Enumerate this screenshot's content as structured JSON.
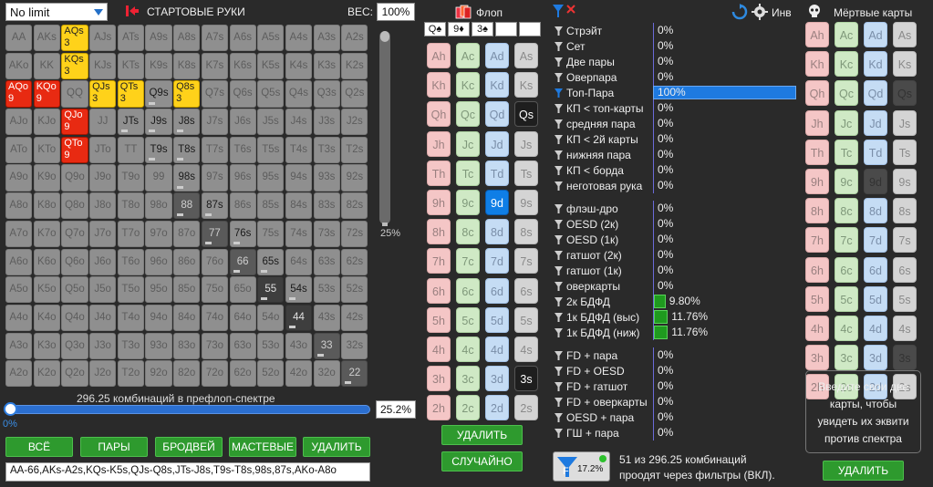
{
  "game_select": "No limit",
  "header": {
    "title": "СТАРТОВЫЕ РУКИ",
    "weight_label": "ВЕС:",
    "weight_value": "100%"
  },
  "grid": [
    [
      [
        "AA",
        "g"
      ],
      [
        "AKs",
        "g"
      ],
      [
        "AQs",
        "y",
        "3"
      ],
      [
        "AJs",
        "g"
      ],
      [
        "ATs",
        "g"
      ],
      [
        "A9s",
        "g"
      ],
      [
        "A8s",
        "g"
      ],
      [
        "A7s",
        "g"
      ],
      [
        "A6s",
        "g"
      ],
      [
        "A5s",
        "g"
      ],
      [
        "A4s",
        "g"
      ],
      [
        "A3s",
        "g"
      ],
      [
        "A2s",
        "g"
      ]
    ],
    [
      [
        "AKo",
        "g"
      ],
      [
        "KK",
        "g"
      ],
      [
        "KQs",
        "y",
        "3"
      ],
      [
        "KJs",
        "g"
      ],
      [
        "KTs",
        "g"
      ],
      [
        "K9s",
        "g"
      ],
      [
        "K8s",
        "g"
      ],
      [
        "K7s",
        "g"
      ],
      [
        "K6s",
        "g"
      ],
      [
        "K5s",
        "g"
      ],
      [
        "K4s",
        "g"
      ],
      [
        "K3s",
        "g"
      ],
      [
        "K2s",
        "g"
      ]
    ],
    [
      [
        "AQo",
        "r",
        "9"
      ],
      [
        "KQo",
        "r",
        "9"
      ],
      [
        "QQ",
        "g"
      ],
      [
        "QJs",
        "y",
        "3"
      ],
      [
        "QTs",
        "y",
        "3"
      ],
      [
        "Q9s",
        "w"
      ],
      [
        "Q8s",
        "y",
        "3"
      ],
      [
        "Q7s",
        "g"
      ],
      [
        "Q6s",
        "g"
      ],
      [
        "Q5s",
        "g"
      ],
      [
        "Q4s",
        "g"
      ],
      [
        "Q3s",
        "g"
      ],
      [
        "Q2s",
        "g"
      ]
    ],
    [
      [
        "AJo",
        "g"
      ],
      [
        "KJo",
        "g"
      ],
      [
        "QJo",
        "r",
        "9"
      ],
      [
        "JJ",
        "g"
      ],
      [
        "JTs",
        "w"
      ],
      [
        "J9s",
        "w"
      ],
      [
        "J8s",
        "w"
      ],
      [
        "J7s",
        "g"
      ],
      [
        "J6s",
        "g"
      ],
      [
        "J5s",
        "g"
      ],
      [
        "J4s",
        "g"
      ],
      [
        "J3s",
        "g"
      ],
      [
        "J2s",
        "g"
      ]
    ],
    [
      [
        "ATo",
        "g"
      ],
      [
        "KTo",
        "g"
      ],
      [
        "QTo",
        "r",
        "9"
      ],
      [
        "JTo",
        "g"
      ],
      [
        "TT",
        "g"
      ],
      [
        "T9s",
        "w"
      ],
      [
        "T8s",
        "w"
      ],
      [
        "T7s",
        "g"
      ],
      [
        "T6s",
        "g"
      ],
      [
        "T5s",
        "g"
      ],
      [
        "T4s",
        "g"
      ],
      [
        "T3s",
        "g"
      ],
      [
        "T2s",
        "g"
      ]
    ],
    [
      [
        "A9o",
        "g"
      ],
      [
        "K9o",
        "g"
      ],
      [
        "Q9o",
        "g"
      ],
      [
        "J9o",
        "g"
      ],
      [
        "T9o",
        "g"
      ],
      [
        "99",
        "g"
      ],
      [
        "98s",
        "w"
      ],
      [
        "97s",
        "g"
      ],
      [
        "96s",
        "g"
      ],
      [
        "95s",
        "g"
      ],
      [
        "94s",
        "g"
      ],
      [
        "93s",
        "g"
      ],
      [
        "92s",
        "g"
      ]
    ],
    [
      [
        "A8o",
        "g"
      ],
      [
        "K8o",
        "g"
      ],
      [
        "Q8o",
        "g"
      ],
      [
        "J8o",
        "g"
      ],
      [
        "T8o",
        "g"
      ],
      [
        "98o",
        "g"
      ],
      [
        "88",
        "d"
      ],
      [
        "87s",
        "w"
      ],
      [
        "86s",
        "g"
      ],
      [
        "85s",
        "g"
      ],
      [
        "84s",
        "g"
      ],
      [
        "83s",
        "g"
      ],
      [
        "82s",
        "g"
      ]
    ],
    [
      [
        "A7o",
        "g"
      ],
      [
        "K7o",
        "g"
      ],
      [
        "Q7o",
        "g"
      ],
      [
        "J7o",
        "g"
      ],
      [
        "T7o",
        "g"
      ],
      [
        "97o",
        "g"
      ],
      [
        "87o",
        "g"
      ],
      [
        "77",
        "d"
      ],
      [
        "76s",
        "w"
      ],
      [
        "75s",
        "g"
      ],
      [
        "74s",
        "g"
      ],
      [
        "73s",
        "g"
      ],
      [
        "72s",
        "g"
      ]
    ],
    [
      [
        "A6o",
        "g"
      ],
      [
        "K6o",
        "g"
      ],
      [
        "Q6o",
        "g"
      ],
      [
        "J6o",
        "g"
      ],
      [
        "T6o",
        "g"
      ],
      [
        "96o",
        "g"
      ],
      [
        "86o",
        "g"
      ],
      [
        "76o",
        "g"
      ],
      [
        "66",
        "d"
      ],
      [
        "65s",
        "w"
      ],
      [
        "64s",
        "g"
      ],
      [
        "63s",
        "g"
      ],
      [
        "62s",
        "g"
      ]
    ],
    [
      [
        "A5o",
        "g"
      ],
      [
        "K5o",
        "g"
      ],
      [
        "Q5o",
        "g"
      ],
      [
        "J5o",
        "g"
      ],
      [
        "T5o",
        "g"
      ],
      [
        "95o",
        "g"
      ],
      [
        "85o",
        "g"
      ],
      [
        "75o",
        "g"
      ],
      [
        "65o",
        "g"
      ],
      [
        "55",
        "e"
      ],
      [
        "54s",
        "w"
      ],
      [
        "53s",
        "g"
      ],
      [
        "52s",
        "g"
      ]
    ],
    [
      [
        "A4o",
        "g"
      ],
      [
        "K4o",
        "g"
      ],
      [
        "Q4o",
        "g"
      ],
      [
        "J4o",
        "g"
      ],
      [
        "T4o",
        "g"
      ],
      [
        "94o",
        "g"
      ],
      [
        "84o",
        "g"
      ],
      [
        "74o",
        "g"
      ],
      [
        "64o",
        "g"
      ],
      [
        "54o",
        "g"
      ],
      [
        "44",
        "e"
      ],
      [
        "43s",
        "g"
      ],
      [
        "42s",
        "g"
      ]
    ],
    [
      [
        "A3o",
        "g"
      ],
      [
        "K3o",
        "g"
      ],
      [
        "Q3o",
        "g"
      ],
      [
        "J3o",
        "g"
      ],
      [
        "T3o",
        "g"
      ],
      [
        "93o",
        "g"
      ],
      [
        "83o",
        "g"
      ],
      [
        "73o",
        "g"
      ],
      [
        "63o",
        "g"
      ],
      [
        "53o",
        "g"
      ],
      [
        "43o",
        "g"
      ],
      [
        "33",
        "d"
      ],
      [
        "32s",
        "g"
      ]
    ],
    [
      [
        "A2o",
        "g"
      ],
      [
        "K2o",
        "g"
      ],
      [
        "Q2o",
        "g"
      ],
      [
        "J2o",
        "g"
      ],
      [
        "T2o",
        "g"
      ],
      [
        "92o",
        "g"
      ],
      [
        "82o",
        "g"
      ],
      [
        "72o",
        "g"
      ],
      [
        "62o",
        "g"
      ],
      [
        "52o",
        "g"
      ],
      [
        "42o",
        "g"
      ],
      [
        "32o",
        "g"
      ],
      [
        "22",
        "d"
      ]
    ]
  ],
  "vslider_pct": "25%",
  "combos_text": "296.25 комбинаций в префлоп-спектре",
  "hslider_left": "0%",
  "hslider_value": "25.2%",
  "buttons": {
    "all": "ВСЁ",
    "pairs": "ПАРЫ",
    "broadway": "БРОДВЕЙ",
    "suited": "МАСТЕВЫЕ",
    "delete": "УДАЛИТЬ"
  },
  "range_text": "AA-66,AKs-A2s,KQs-K5s,QJs-Q8s,JTs-J8s,T9s-T8s,98s,87s,AKo-A8o",
  "flop": {
    "label": "Флоп",
    "slots": [
      "Q♠",
      "9♦",
      "3♠",
      "",
      ""
    ],
    "cards": [
      [
        "Ah",
        "p"
      ],
      [
        "Ac",
        "g"
      ],
      [
        "Ad",
        "b"
      ],
      [
        "As",
        "x"
      ],
      [
        "Kh",
        "p"
      ],
      [
        "Kc",
        "g"
      ],
      [
        "Kd",
        "b"
      ],
      [
        "Ks",
        "x"
      ],
      [
        "Qh",
        "p"
      ],
      [
        "Qc",
        "g"
      ],
      [
        "Qd",
        "b"
      ],
      [
        "Qs",
        "k"
      ],
      [
        "Jh",
        "p"
      ],
      [
        "Jc",
        "g"
      ],
      [
        "Jd",
        "b"
      ],
      [
        "Js",
        "x"
      ],
      [
        "Th",
        "p"
      ],
      [
        "Tc",
        "g"
      ],
      [
        "Td",
        "b"
      ],
      [
        "Ts",
        "x"
      ],
      [
        "9h",
        "p"
      ],
      [
        "9c",
        "g"
      ],
      [
        "9d",
        "s"
      ],
      [
        "9s",
        "x"
      ],
      [
        "8h",
        "p"
      ],
      [
        "8c",
        "g"
      ],
      [
        "8d",
        "b"
      ],
      [
        "8s",
        "x"
      ],
      [
        "7h",
        "p"
      ],
      [
        "7c",
        "g"
      ],
      [
        "7d",
        "b"
      ],
      [
        "7s",
        "x"
      ],
      [
        "6h",
        "p"
      ],
      [
        "6c",
        "g"
      ],
      [
        "6d",
        "b"
      ],
      [
        "6s",
        "x"
      ],
      [
        "5h",
        "p"
      ],
      [
        "5c",
        "g"
      ],
      [
        "5d",
        "b"
      ],
      [
        "5s",
        "x"
      ],
      [
        "4h",
        "p"
      ],
      [
        "4c",
        "g"
      ],
      [
        "4d",
        "b"
      ],
      [
        "4s",
        "x"
      ],
      [
        "3h",
        "p"
      ],
      [
        "3c",
        "g"
      ],
      [
        "3d",
        "b"
      ],
      [
        "3s",
        "k"
      ],
      [
        "2h",
        "p"
      ],
      [
        "2c",
        "g"
      ],
      [
        "2d",
        "b"
      ],
      [
        "2s",
        "x"
      ]
    ],
    "delete": "УДАЛИТЬ",
    "random": "СЛУЧАЙНО"
  },
  "stats": {
    "made": [
      {
        "label": "Стрэйт",
        "value": "0%"
      },
      {
        "label": "Сет",
        "value": "0%"
      },
      {
        "label": "Две пары",
        "value": "0%"
      },
      {
        "label": "Оверпара",
        "value": "0%"
      },
      {
        "label": "Топ-Пара",
        "value": "100%",
        "hl": 1
      },
      {
        "label": "КП < топ-карты",
        "value": "0%"
      },
      {
        "label": "средняя пара",
        "value": "0%"
      },
      {
        "label": "КП < 2й карты",
        "value": "0%"
      },
      {
        "label": "нижняя пара",
        "value": "0%"
      },
      {
        "label": "КП < борда",
        "value": "0%"
      },
      {
        "label": "неготовая рука",
        "value": "0%"
      }
    ],
    "draws": [
      {
        "label": "флэш-дро",
        "value": "0%"
      },
      {
        "label": "OESD (2к)",
        "value": "0%"
      },
      {
        "label": "OESD (1к)",
        "value": "0%"
      },
      {
        "label": "гатшот (2к)",
        "value": "0%"
      },
      {
        "label": "гатшот (1к)",
        "value": "0%"
      },
      {
        "label": "оверкарты",
        "value": "0%"
      },
      {
        "label": "2к БДФД",
        "value": "9.80%",
        "g": 1
      },
      {
        "label": "1к БДФД (выс)",
        "value": "11.76%",
        "g": 1
      },
      {
        "label": "1к БДФД (ниж)",
        "value": "11.76%",
        "g": 1
      }
    ],
    "combos": [
      {
        "label": "FD + пара",
        "value": "0%"
      },
      {
        "label": "FD + OESD",
        "value": "0%"
      },
      {
        "label": "FD + гатшот",
        "value": "0%"
      },
      {
        "label": "FD + оверкарты",
        "value": "0%"
      },
      {
        "label": "OESD + пара",
        "value": "0%"
      },
      {
        "label": "ГШ + пара",
        "value": "0%"
      }
    ]
  },
  "inv_label": "Инв",
  "filter": {
    "pct": "17.2%",
    "line1": "51 из 296.25 комбинаций",
    "line2": "проодят через фильтры (ВКЛ)."
  },
  "dead": {
    "label": "Мёртвые карты",
    "cards": [
      [
        "Ah",
        "p"
      ],
      [
        "Ac",
        "g"
      ],
      [
        "Ad",
        "b"
      ],
      [
        "As",
        "x"
      ],
      [
        "Kh",
        "p"
      ],
      [
        "Kc",
        "g"
      ],
      [
        "Kd",
        "b"
      ],
      [
        "Ks",
        "x"
      ],
      [
        "Qh",
        "p"
      ],
      [
        "Qc",
        "g"
      ],
      [
        "Qd",
        "b"
      ],
      [
        "Qs",
        "z"
      ],
      [
        "Jh",
        "p"
      ],
      [
        "Jc",
        "g"
      ],
      [
        "Jd",
        "b"
      ],
      [
        "Js",
        "x"
      ],
      [
        "Th",
        "p"
      ],
      [
        "Tc",
        "g"
      ],
      [
        "Td",
        "b"
      ],
      [
        "Ts",
        "x"
      ],
      [
        "9h",
        "p"
      ],
      [
        "9c",
        "g"
      ],
      [
        "9d",
        "z"
      ],
      [
        "9s",
        "x"
      ],
      [
        "8h",
        "p"
      ],
      [
        "8c",
        "g"
      ],
      [
        "8d",
        "b"
      ],
      [
        "8s",
        "x"
      ],
      [
        "7h",
        "p"
      ],
      [
        "7c",
        "g"
      ],
      [
        "7d",
        "b"
      ],
      [
        "7s",
        "x"
      ],
      [
        "6h",
        "p"
      ],
      [
        "6c",
        "g"
      ],
      [
        "6d",
        "b"
      ],
      [
        "6s",
        "x"
      ],
      [
        "5h",
        "p"
      ],
      [
        "5c",
        "g"
      ],
      [
        "5d",
        "b"
      ],
      [
        "5s",
        "x"
      ],
      [
        "4h",
        "p"
      ],
      [
        "4c",
        "g"
      ],
      [
        "4d",
        "b"
      ],
      [
        "4s",
        "x"
      ],
      [
        "3h",
        "p"
      ],
      [
        "3c",
        "g"
      ],
      [
        "3d",
        "b"
      ],
      [
        "3s",
        "z"
      ],
      [
        "2h",
        "p"
      ],
      [
        "2c",
        "g"
      ],
      [
        "2d",
        "b"
      ],
      [
        "2s",
        "x"
      ]
    ],
    "info": "Введите свои две карты, чтобы увидеть их эквити против спектра",
    "delete": "УДАЛИТЬ"
  }
}
